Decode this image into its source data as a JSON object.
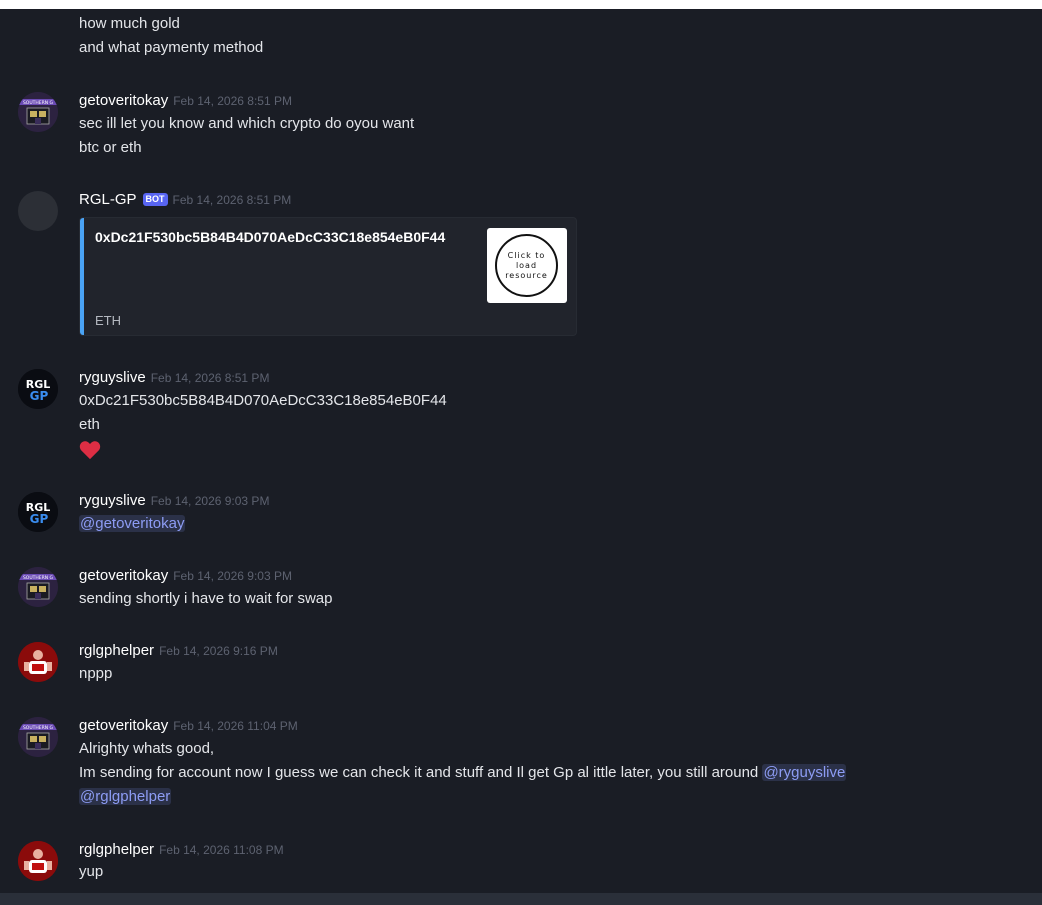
{
  "colors": {
    "background": "#1a1d25",
    "mention_bg": "#2b3148",
    "mention_text": "#8d9cf4",
    "embed_accent": "#4aa3f5",
    "bot_badge": "#5865f2"
  },
  "messages": {
    "m0": {
      "lines": [
        "how much gold",
        "and what paymenty method"
      ]
    },
    "m1": {
      "author": "getoveritokay",
      "timestamp": "Feb 14, 2026 8:51 PM",
      "lines": [
        "sec ill let you know and which crypto do  oyou want",
        "btc or eth"
      ]
    },
    "m2": {
      "author": "RGL-GP",
      "bot_badge": "BOT",
      "timestamp": "Feb 14, 2026 8:51 PM",
      "embed": {
        "title": "0xDc21F530bc5B84B4D070AeDcC33C18e854eB0F44",
        "footer": "ETH",
        "thumbnail_text": "Click to load resource"
      }
    },
    "m3": {
      "author": "ryguyslive",
      "timestamp": "Feb 14, 2026 8:51 PM",
      "lines": [
        "0xDc21F530bc5B84B4D070AeDcC33C18e854eB0F44",
        "eth"
      ],
      "reaction": "heart-emoji"
    },
    "m4": {
      "author": "ryguyslive",
      "timestamp": "Feb 14, 2026 9:03 PM",
      "mention": "@getoveritokay"
    },
    "m5": {
      "author": "getoveritokay",
      "timestamp": "Feb 14, 2026 9:03 PM",
      "lines": [
        "sending shortly i have to wait for swap"
      ]
    },
    "m6": {
      "author": "rglgphelper",
      "timestamp": "Feb 14, 2026 9:16 PM",
      "lines": [
        "nppp"
      ]
    },
    "m7": {
      "author": "getoveritokay",
      "timestamp": "Feb 14, 2026 11:04 PM",
      "line1": "Alrighty whats good,",
      "line2": "Im sending for account now I guess we can check it and stuff and Il get Gp al ittle later, you still around ",
      "mention1": "@ryguyslive",
      "mention2": "@rglgphelper"
    },
    "m8": {
      "author": "rglgphelper",
      "timestamp": "Feb 14, 2026 11:08 PM",
      "lines": [
        "yup"
      ]
    }
  },
  "avatar_labels": {
    "rgl_top": "RGL",
    "rgl_bottom": "GP",
    "southern": "SOUTHERN G"
  }
}
